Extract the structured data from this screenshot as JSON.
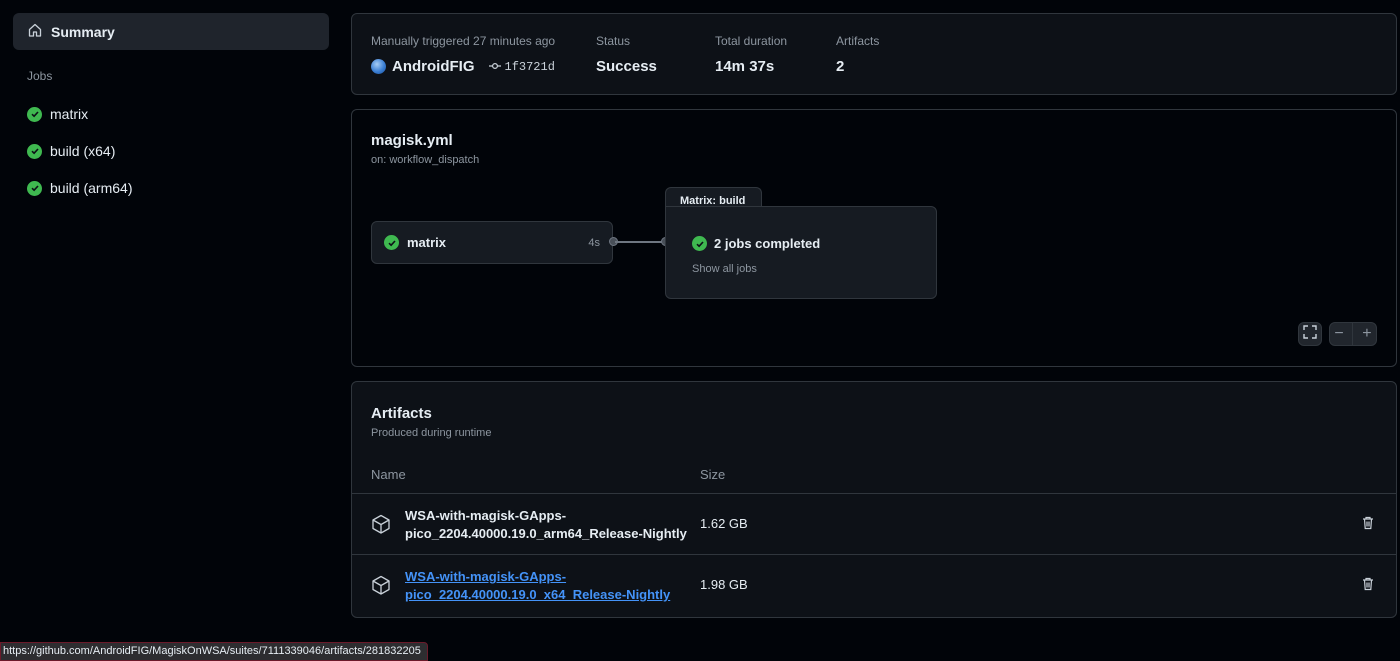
{
  "sidebar": {
    "summary_label": "Summary",
    "jobs_heading": "Jobs",
    "jobs": [
      {
        "label": "matrix"
      },
      {
        "label": "build (x64)"
      },
      {
        "label": "build (arm64)"
      }
    ]
  },
  "run_info": {
    "trigger_label": "Manually triggered 27 minutes ago",
    "actor": "AndroidFIG",
    "commit": "1f3721d",
    "status_label": "Status",
    "status_value": "Success",
    "duration_label": "Total duration",
    "duration_value": "14m 37s",
    "artifacts_label": "Artifacts",
    "artifacts_value": "2"
  },
  "workflow": {
    "title": "magisk.yml",
    "trigger": "on: workflow_dispatch",
    "job_name": "matrix",
    "job_duration": "4s",
    "matrix_tab": "Matrix: build",
    "matrix_status": "2 jobs completed",
    "matrix_link": "Show all jobs",
    "controls": {
      "fullscreen": "⛶",
      "zoom_out": "−",
      "zoom_in": "+"
    }
  },
  "artifacts": {
    "title": "Artifacts",
    "subtitle": "Produced during runtime",
    "col_name": "Name",
    "col_size": "Size",
    "rows": [
      {
        "name_line1": "WSA-with-magisk-GApps-",
        "name_line2": "pico_2204.40000.19.0_arm64_Release-Nightly",
        "size": "1.62 GB"
      },
      {
        "name_line1": "WSA-with-magisk-GApps-",
        "name_line2": "pico_2204.40000.19.0_x64_Release-Nightly",
        "size": "1.98 GB"
      }
    ]
  },
  "status_bar": {
    "url": "https://github.com/AndroidFIG/MagiskOnWSA/suites/7111339046/artifacts/281832205"
  },
  "colors": {
    "success": "#3fb950",
    "link": "#4493f8",
    "background": "#010409",
    "panel": "#0d1117",
    "border": "#30363d"
  }
}
